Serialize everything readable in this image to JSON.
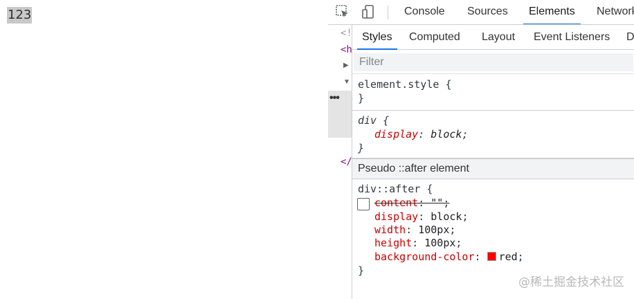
{
  "page": {
    "text": "123"
  },
  "toolbar": {
    "tabs": [
      "Console",
      "Sources",
      "Elements",
      "Network"
    ],
    "active_tab": "Elements",
    "icons": [
      "inspect-element-icon",
      "device-toolbar-icon"
    ]
  },
  "dom_tree": {
    "lines": [
      "<!",
      "<h",
      "</"
    ],
    "dots": "•••"
  },
  "styles_pane": {
    "tabs": [
      "Styles",
      "Computed",
      "Layout",
      "Event Listeners",
      "D"
    ],
    "active_tab": "Styles",
    "filter_placeholder": "Filter",
    "rules": {
      "element_style": {
        "selector": "element.style",
        "open": "{",
        "close": "}"
      },
      "div_rule": {
        "selector": "div",
        "open": "{",
        "close": "}",
        "properties": [
          {
            "name": "display",
            "value": "block"
          }
        ]
      },
      "pseudo_header": "Pseudo ::after element",
      "after_rule": {
        "selector": "div::after",
        "open": "{",
        "close": "}",
        "properties": [
          {
            "name": "content",
            "value": "\"\"",
            "overridden": true
          },
          {
            "name": "display",
            "value": "block"
          },
          {
            "name": "width",
            "value": "100px"
          },
          {
            "name": "height",
            "value": "100px"
          },
          {
            "name": "background-color",
            "value": "red",
            "swatch_color": "#ff0000"
          }
        ]
      }
    }
  },
  "watermark": "@稀土掘金技术社区",
  "colors": {
    "accent": "#1a73e8",
    "property": "#c80000"
  }
}
